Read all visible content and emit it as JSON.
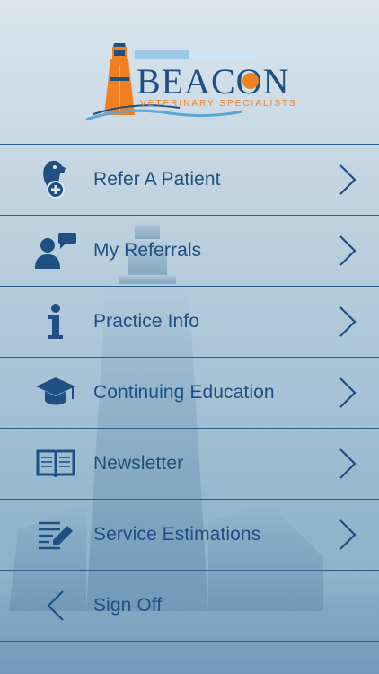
{
  "brand": {
    "name": "BEACON",
    "tagline": "VETERINARY SPECIALISTS",
    "colors": {
      "navy": "#1f4f83",
      "orange": "#f0811e",
      "light_blue": "#5aa7d6"
    }
  },
  "menu": {
    "items": [
      {
        "label": "Refer A Patient",
        "icon": "dog-medical-icon"
      },
      {
        "label": "My Referrals",
        "icon": "person-chat-icon"
      },
      {
        "label": "Practice Info",
        "icon": "info-icon"
      },
      {
        "label": "Continuing Education",
        "icon": "graduation-cap-icon"
      },
      {
        "label": "Newsletter",
        "icon": "open-book-icon"
      },
      {
        "label": "Service Estimations",
        "icon": "document-edit-icon"
      }
    ],
    "sign_off": {
      "label": "Sign Off",
      "icon": "chevron-left-icon"
    }
  }
}
